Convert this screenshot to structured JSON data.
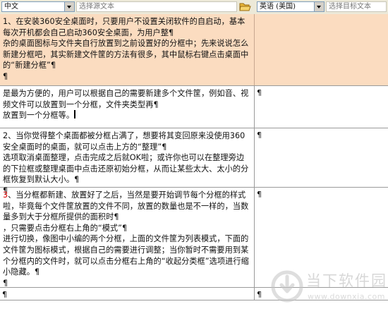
{
  "toolbar": {
    "source_language": "中文",
    "source_placeholder": "选择源文本",
    "target_language": "英语 (美国)",
    "target_placeholder": "选择目标文本"
  },
  "rows": [
    {
      "source": "1、在安装360安全桌面时，只要用户不设置关闭软件的自启动，基本每次开机都会自己启动360安全桌面，为用户整¶\n杂的桌面图标与文件夹自行放置到之前设置好的分框中；先来说说怎么新建分框吧，其实新建文件筐的方法有很多，其中鼠标右键点击桌面中的“新建分框”¶\n¶",
      "target": ""
    },
    {
      "source": "是最为方便的，用户可以根据自己的需要新建多个文件筐，例如音、视频文件可以放置到一个分框，文件夹类型再¶\n放置到一个分框等。",
      "target": "¶"
    },
    {
      "source": "2、当你觉得整个桌面都被分框占满了，想要将其变回原来没使用360安全桌面时的桌面，就可以点击上方的“整理”¶\n选项取消桌面整理，点击完成之后就OK啦；或许你也可以在整理旁边的下拉框或整理桌面中点击还原初始分框，从而让某些太大、太小的分框恢复到默认大小。¶\n¶",
      "target": "¶"
    },
    {
      "source_num": "3",
      "source": "、当分框都新建、放置好了之后，当然是要开始调节每个分框的样式啦，毕竟每个文件筐放置的文件不同，放置的数量也是不一样的，当数量多到大于分框所提供的面积时¶\n，只需要点击分框右上角的“模式”¶\n进行切换，像图中小编的两个分框，上面的文件筐为列表模式，下面的文件筐为图标模式，根据自己的需要进行调整；当你暂时不需要用到某个分框内的文件时，就可以点击分框右上角的“收起分类框”选项进行缩小隐藏。¶\n¶",
      "target": "¶"
    },
    {
      "source": "¶",
      "target": "¶"
    }
  ],
  "watermark": {
    "text": "当下软件园",
    "sub": "www.downxia.com"
  }
}
